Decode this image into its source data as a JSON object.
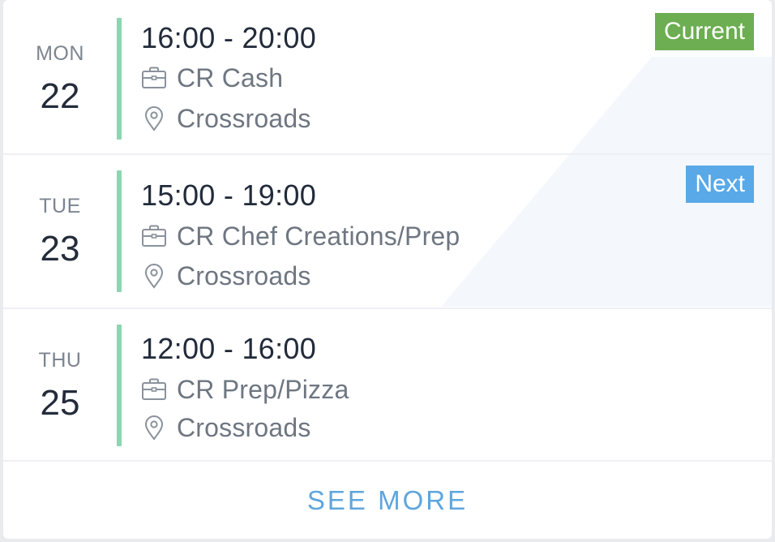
{
  "badges": {
    "current": "Current",
    "next": "Next",
    "current_color": "#6cae51",
    "next_color": "#59a9e8"
  },
  "shifts": [
    {
      "day": "MON",
      "date": "22",
      "time": "16:00 - 20:00",
      "role": "CR Cash",
      "location": "Crossroads",
      "status": "current"
    },
    {
      "day": "TUE",
      "date": "23",
      "time": "15:00 - 19:00",
      "role": "CR Chef Creations/Prep",
      "location": "Crossroads",
      "status": "next"
    },
    {
      "day": "THU",
      "date": "25",
      "time": "12:00 - 16:00",
      "role": "CR Prep/Pizza",
      "location": "Crossroads",
      "status": ""
    }
  ],
  "footer": {
    "see_more_label": "SEE MORE"
  },
  "icons": {
    "role": "briefcase-icon",
    "location": "map-pin-icon"
  },
  "colors": {
    "accent_bar": "#8fd4b0",
    "link": "#5ea6dd"
  }
}
